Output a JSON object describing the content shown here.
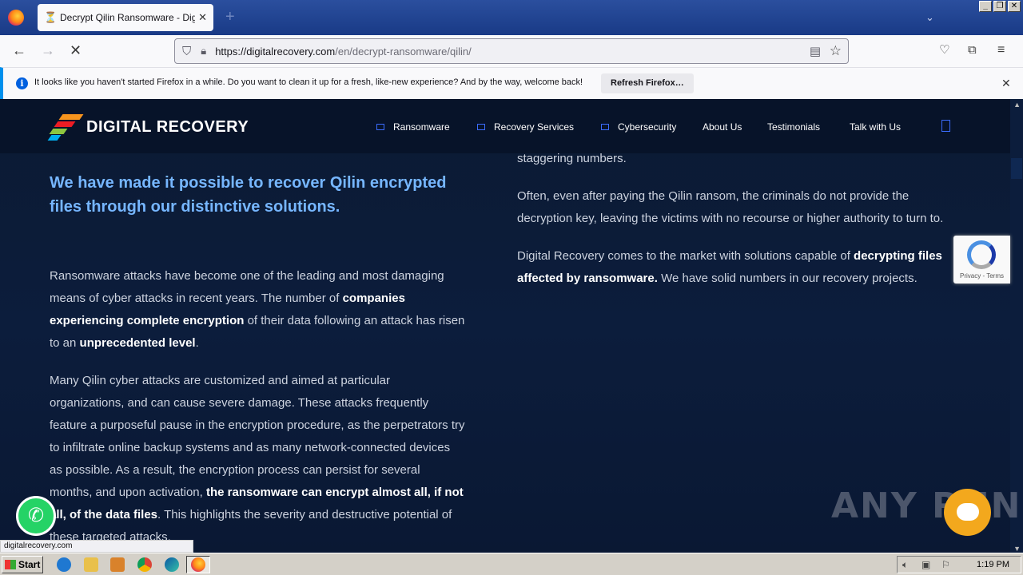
{
  "browser": {
    "tab_title": "Decrypt Qilin Ransomware - Digital",
    "url_host": "https://digitalrecovery.com",
    "url_path": "/en/decrypt-ransomware/qilin/",
    "notification_text": "It looks like you haven't started Firefox in a while. Do you want to clean it up for a fresh, like-new experience? And by the way, welcome back!",
    "notification_button": "Refresh Firefox…",
    "status_url": "digitalrecovery.com"
  },
  "site": {
    "logo_text": "DIGITAL RECOVERY",
    "menu": [
      {
        "label": "Ransomware"
      },
      {
        "label": "Recovery Services"
      },
      {
        "label": "Cybersecurity"
      },
      {
        "label": "About Us"
      },
      {
        "label": "Testimonials"
      },
      {
        "label": "Talk with Us"
      }
    ]
  },
  "content": {
    "heading": "We have made it possible to recover Qilin encrypted files through our distinctive solutions.",
    "left_p1": {
      "t1": "Ransomware attacks have become one of the leading and most damaging means of cyber attacks in recent years. The number of ",
      "b1": "companies experiencing complete encryption",
      "t2": " of their data following an attack has risen to an ",
      "b2": "unprecedented level",
      "t3": "."
    },
    "left_p2": {
      "t1": "Many Qilin cyber attacks are customized and aimed at particular organizations, and can cause severe damage. These attacks frequently feature a purposeful pause in the encryption procedure, as the perpetrators try to infiltrate online backup systems and as many network-connected devices as possible. As a result, the encryption process can persist for several months, and upon activation, ",
      "b1": "the ransomware can encrypt almost all, if not all, of the data files",
      "t2": ". This highlights the severity and destructive potential of these targeted attacks."
    },
    "right_p0": "staggering numbers.",
    "right_p1": "Often, even after paying the Qilin ransom, the criminals do not provide the decryption key, leaving the victims with no recourse or higher authority to turn to.",
    "right_p2": {
      "t1": "Digital Recovery comes to the market with solutions capable of ",
      "b1": "decrypting files affected by ransomware.",
      "t2": " We have solid numbers in our recovery projects."
    }
  },
  "widgets": {
    "recaptcha_text": "Privacy - Terms",
    "watermark": "ANY RUN"
  },
  "taskbar": {
    "start_label": "Start",
    "clock": "1:19 PM"
  }
}
